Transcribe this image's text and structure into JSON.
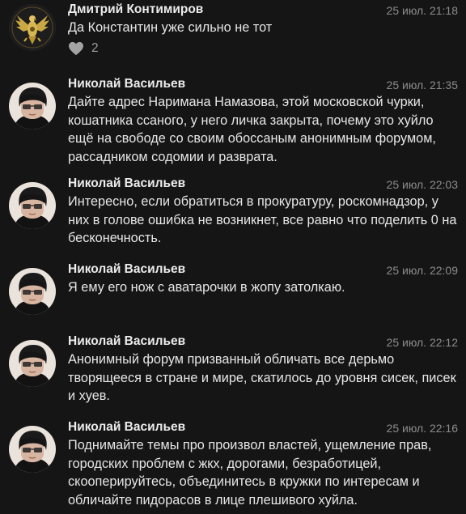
{
  "comments": [
    {
      "author": "Дмитрий Контимиров",
      "time": "25 июл. 21:18",
      "text": "Да Константин уже сильно не тот",
      "likes": "2",
      "avatar_icon": "eagle-emblem-icon"
    },
    {
      "author": "Николай Васильев",
      "time": "25 июл. 21:35",
      "text": "Дайте адрес Наримана Намазова, этой московской чурки, кошатника ссаного, у него личка закрыта, почему это хуйло ещё на свободе со своим обоссаным анонимным форумом, рассадником содомии и разврата.",
      "avatar_icon": "person-with-glasses-icon"
    },
    {
      "author": "Николай Васильев",
      "time": "25 июл. 22:03",
      "text": "Интересно, если обратиться в прокуратуру, роскомнадзор, у них в голове ошибка не возникнет, все равно что поделить 0 на бесконечность.",
      "avatar_icon": "person-with-glasses-icon"
    },
    {
      "author": "Николай Васильев",
      "time": "25 июл. 22:09",
      "text": "Я ему его нож с аватарочки в жопу затолкаю.",
      "avatar_icon": "person-with-glasses-icon"
    },
    {
      "author": "Николай Васильев",
      "time": "25 июл. 22:12",
      "text": "Анонимный форум призванный обличать все дерьмо творящееся в стране и мире, скатилось до уровня сисек, писек и хуев.",
      "avatar_icon": "person-with-glasses-icon"
    },
    {
      "author": "Николай Васильев",
      "time": "25 июл. 22:16",
      "text": "Поднимайте темы про произвол властей, ущемление прав, городских проблем с жкх, дорогами, безработицей, скооперируйтесь, объединитесь в кружки по интересам и обличайте пидорасов в лице плешивого хуйла.",
      "avatar_icon": "person-with-glasses-icon"
    }
  ],
  "colors": {
    "background": "#151515",
    "text": "#e6e6e6",
    "author": "#ececec",
    "meta": "#8c8c8c",
    "heart": "#9b9b9b"
  }
}
